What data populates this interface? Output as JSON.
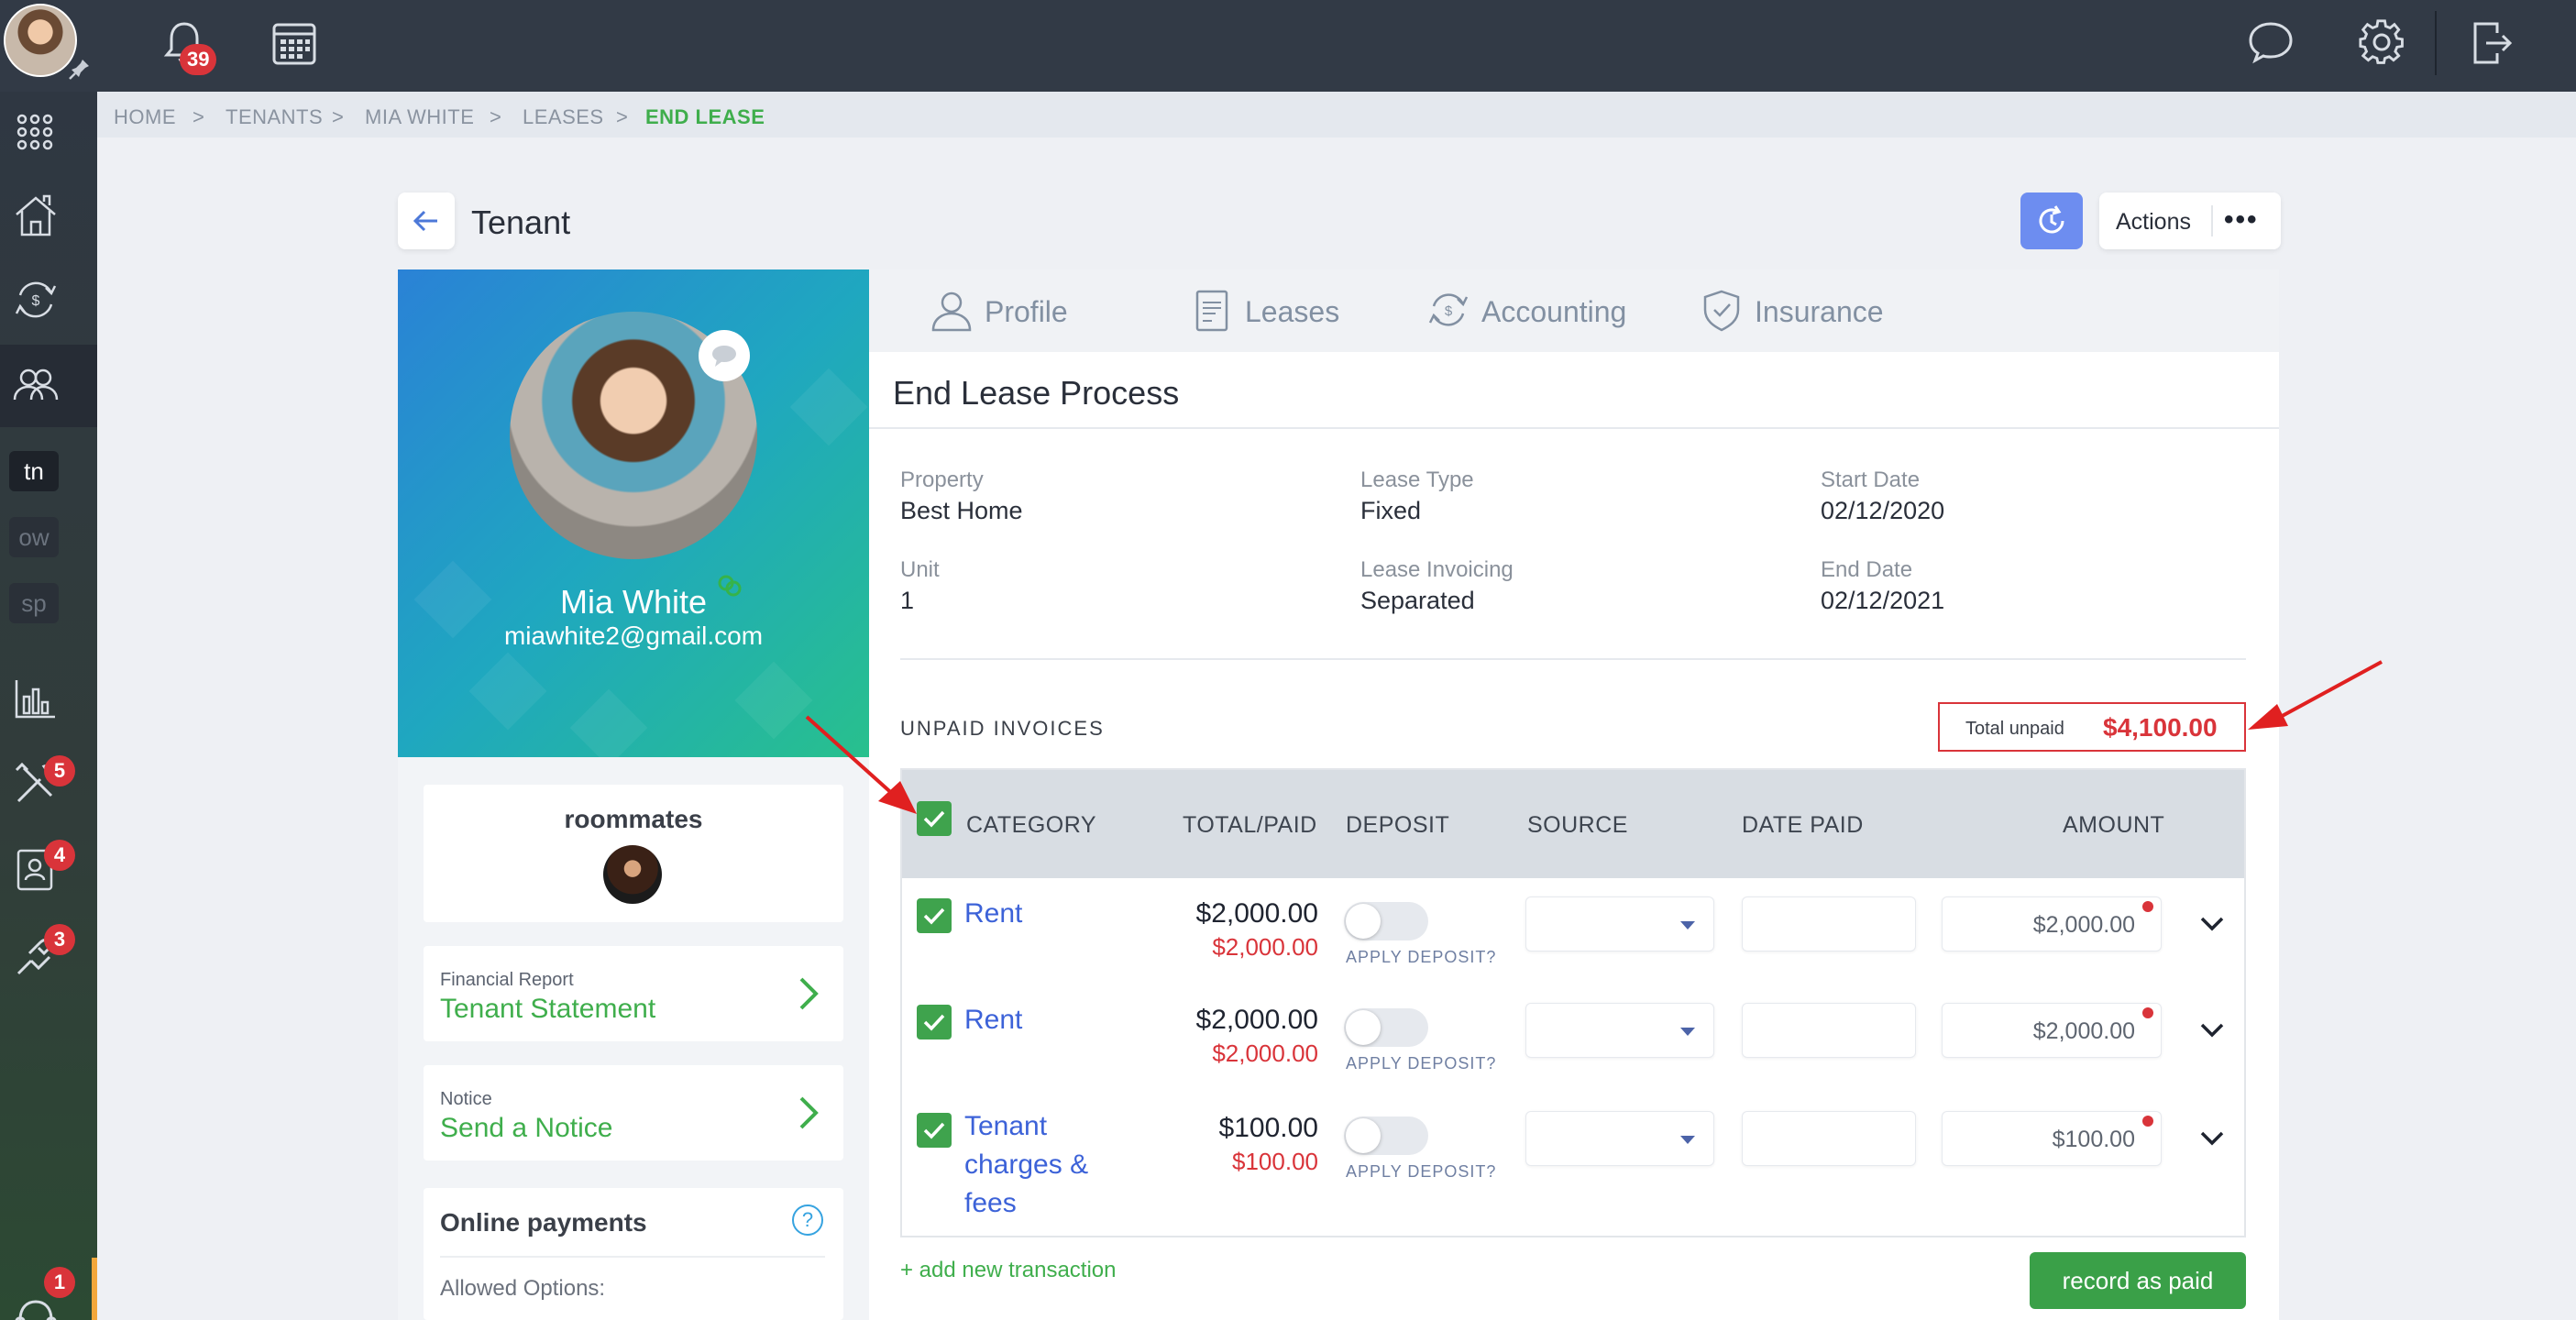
{
  "topbar": {
    "notifications_count": "39",
    "icons": [
      "bell-icon",
      "calendar-icon",
      "chat-icon",
      "settings-icon",
      "logout-icon"
    ]
  },
  "sidebar": {
    "items": [
      {
        "name": "apps-grid-icon"
      },
      {
        "name": "properties-icon"
      },
      {
        "name": "accounting-icon"
      },
      {
        "name": "tenants-icon",
        "active": true
      },
      {
        "abbr": "tn"
      },
      {
        "abbr": "ow"
      },
      {
        "abbr": "sp"
      },
      {
        "name": "reports-icon"
      },
      {
        "name": "maintenance-icon",
        "badge": "5"
      },
      {
        "name": "applications-icon",
        "badge": "4"
      },
      {
        "name": "tools-icon",
        "badge": "3"
      },
      {
        "name": "support-icon",
        "badge": "1"
      }
    ]
  },
  "breadcrumb": {
    "items": [
      "HOME",
      "TENANTS",
      "MIA WHITE",
      "LEASES",
      "END LEASE"
    ],
    "separator": ">"
  },
  "header": {
    "title": "Tenant",
    "actions_label": "Actions",
    "more_label": "•••"
  },
  "profile": {
    "name": "Mia White",
    "email": "miawhite2@gmail.com",
    "roommates_title": "roommates",
    "links": [
      {
        "small": "Financial Report",
        "big": "Tenant Statement"
      },
      {
        "small": "Notice",
        "big": "Send a Notice"
      }
    ],
    "payments_title": "Online payments",
    "payments_help": "?",
    "payments_sub": "Allowed Options:"
  },
  "tabs": [
    {
      "label": "Profile",
      "icon": "user-icon"
    },
    {
      "label": "Leases",
      "icon": "document-icon"
    },
    {
      "label": "Accounting",
      "icon": "currency-cycle-icon"
    },
    {
      "label": "Insurance",
      "icon": "shield-icon"
    }
  ],
  "lease": {
    "section_title": "End Lease Process",
    "fields": [
      {
        "label": "Property",
        "value": "Best Home"
      },
      {
        "label": "Lease Type",
        "value": "Fixed"
      },
      {
        "label": "Start Date",
        "value": "02/12/2020"
      },
      {
        "label": "Unit",
        "value": "1"
      },
      {
        "label": "Lease Invoicing",
        "value": "Separated"
      },
      {
        "label": "End Date",
        "value": "02/12/2021"
      }
    ]
  },
  "invoices": {
    "title": "UNPAID INVOICES",
    "total_label": "Total unpaid",
    "total_value": "$4,100.00",
    "columns": [
      "CATEGORY",
      "TOTAL/PAID",
      "DEPOSIT",
      "SOURCE",
      "DATE PAID",
      "AMOUNT"
    ],
    "apply_deposit_label": "APPLY DEPOSIT?",
    "rows": [
      {
        "category": "Rent",
        "total": "$2,000.00",
        "paid": "$2,000.00",
        "amount": "$2,000.00",
        "checked": true
      },
      {
        "category": "Rent",
        "total": "$2,000.00",
        "paid": "$2,000.00",
        "amount": "$2,000.00",
        "checked": true
      },
      {
        "category": "Tenant charges & fees",
        "total": "$100.00",
        "paid": "$100.00",
        "amount": "$100.00",
        "checked": true
      }
    ],
    "add_transaction": "+ add new transaction",
    "record_button": "record as paid"
  },
  "colors": {
    "topbar": "#323a46",
    "accent_green": "#3fae4c",
    "link_blue": "#3c62d8",
    "alert_red": "#d9343a",
    "history_button": "#6d8df0"
  }
}
